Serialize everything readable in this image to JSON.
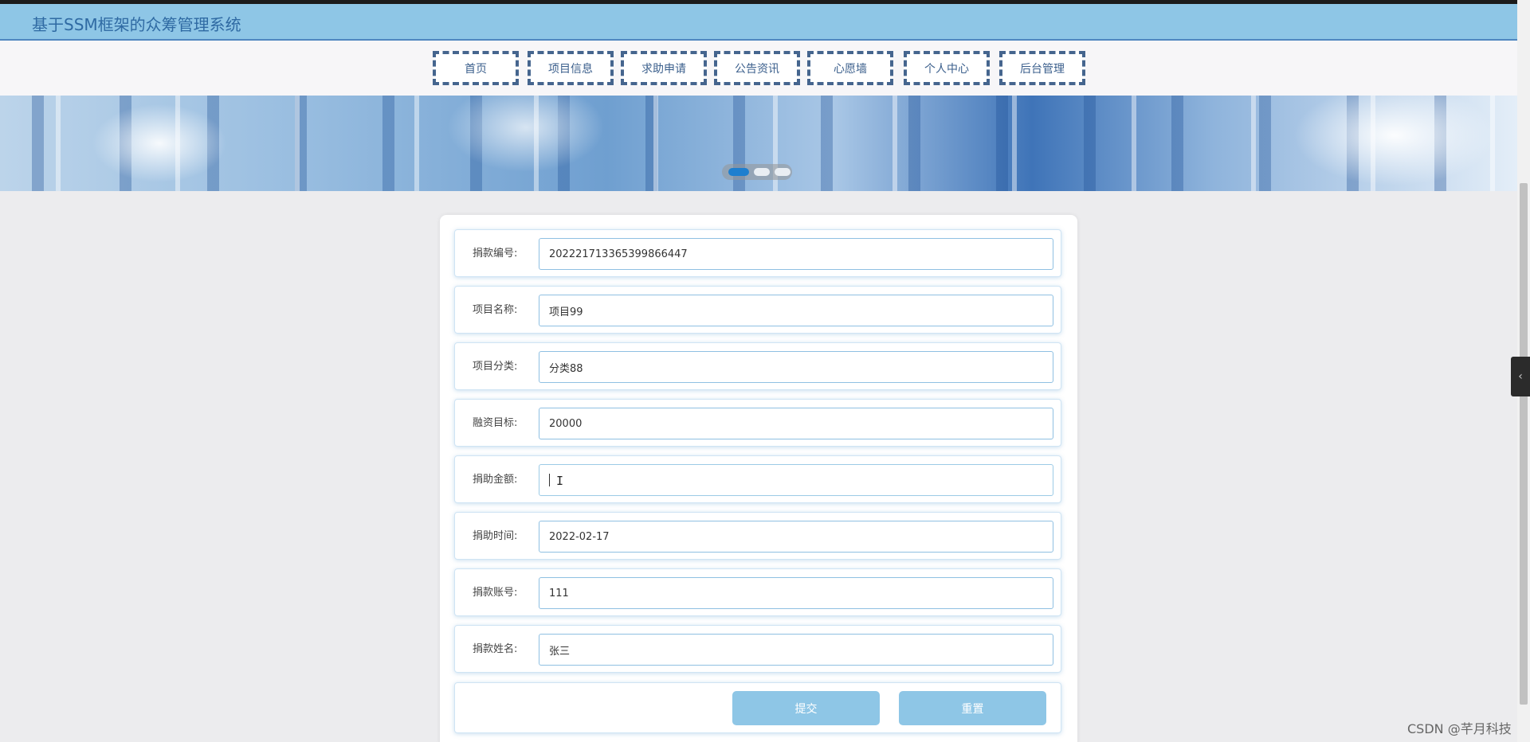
{
  "header": {
    "title": "基于SSM框架的众筹管理系统",
    "accent_color": "#8ec6e6"
  },
  "nav": {
    "items": [
      {
        "label": "首页"
      },
      {
        "label": "项目信息"
      },
      {
        "label": "求助申请"
      },
      {
        "label": "公告资讯"
      },
      {
        "label": "心愿墙"
      },
      {
        "label": "个人中心"
      },
      {
        "label": "后台管理"
      }
    ]
  },
  "carousel": {
    "slide_count": 3,
    "active_index": 1
  },
  "form": {
    "fields": [
      {
        "label": "捐款编号:",
        "value": "202221713365399866447"
      },
      {
        "label": "项目名称:",
        "value": "项目99"
      },
      {
        "label": "项目分类:",
        "value": "分类88"
      },
      {
        "label": "融资目标:",
        "value": "20000"
      },
      {
        "label": "捐助金额:",
        "value": ""
      },
      {
        "label": "捐助时间:",
        "value": "2022-02-17"
      },
      {
        "label": "捐款账号:",
        "value": "111"
      },
      {
        "label": "捐款姓名:",
        "value": "张三"
      }
    ],
    "submit_label": "提交",
    "reset_label": "重置"
  },
  "side_toggle": {
    "icon": "chevron-left-icon",
    "glyph": "‹"
  },
  "watermark": "CSDN @芊月科技"
}
